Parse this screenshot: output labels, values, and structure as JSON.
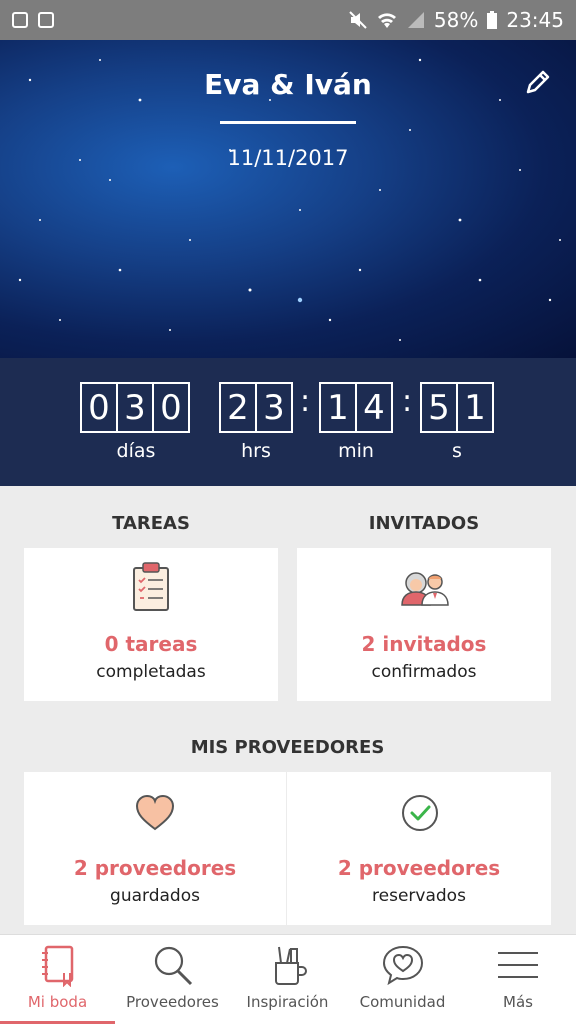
{
  "status_bar": {
    "battery": "58%",
    "time": "23:45"
  },
  "hero": {
    "title": "Eva & Iván",
    "date": "11/11/2017"
  },
  "countdown": {
    "days": [
      "0",
      "3",
      "0"
    ],
    "hours": [
      "2",
      "3"
    ],
    "minutes": [
      "1",
      "4"
    ],
    "seconds": [
      "5",
      "1"
    ],
    "separator": ":",
    "labels": {
      "days": "días",
      "hours": "hrs",
      "minutes": "min",
      "seconds": "s"
    }
  },
  "tasks": {
    "title": "TAREAS",
    "value": "0 tareas",
    "caption": "completadas"
  },
  "guests": {
    "title": "INVITADOS",
    "value": "2 invitados",
    "caption": "confirmados"
  },
  "vendors": {
    "title": "MIS PROVEEDORES",
    "saved": {
      "value": "2 proveedores",
      "caption": "guardados"
    },
    "booked": {
      "value": "2 proveedores",
      "caption": "reservados"
    }
  },
  "nav": {
    "items": [
      {
        "label": "Mi boda",
        "icon": "notebook-icon",
        "active": true
      },
      {
        "label": "Proveedores",
        "icon": "search-icon",
        "active": false
      },
      {
        "label": "Inspiración",
        "icon": "pencil-cup-icon",
        "active": false
      },
      {
        "label": "Comunidad",
        "icon": "chat-heart-icon",
        "active": false
      },
      {
        "label": "Más",
        "icon": "menu-icon",
        "active": false
      }
    ]
  },
  "colors": {
    "accent": "#e0666b",
    "countdown_bg": "#1d2c52",
    "hero_bg": "#0b2158"
  }
}
